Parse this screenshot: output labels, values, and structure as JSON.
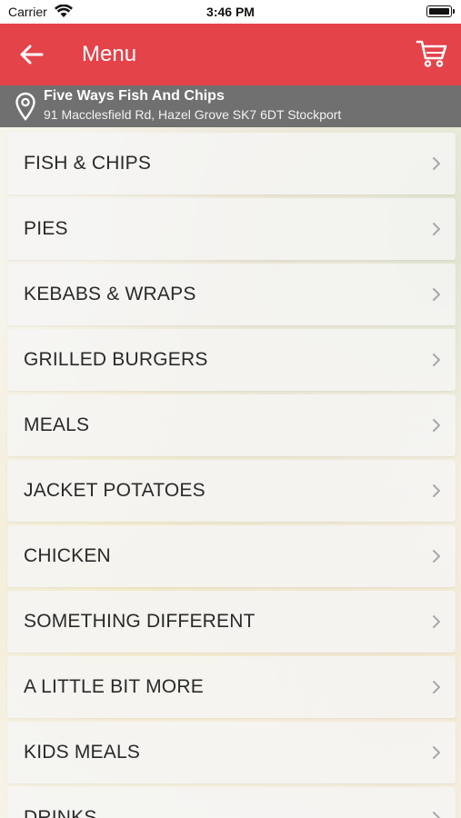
{
  "status_bar": {
    "carrier": "Carrier",
    "time": "3:46 PM"
  },
  "header": {
    "title": "Menu",
    "back_icon": "arrow-left-icon",
    "cart_icon": "cart-icon",
    "color": "#e4434a"
  },
  "location": {
    "name": "Five Ways Fish And Chips",
    "address": "91 Macclesfield Rd, Hazel Grove SK7 6DT Stockport",
    "icon": "map-pin-icon"
  },
  "menu": {
    "items": [
      {
        "label": "FISH & CHIPS"
      },
      {
        "label": "PIES"
      },
      {
        "label": "KEBABS & WRAPS"
      },
      {
        "label": "GRILLED BURGERS"
      },
      {
        "label": "MEALS"
      },
      {
        "label": "JACKET POTATOES"
      },
      {
        "label": "CHICKEN"
      },
      {
        "label": "SOMETHING DIFFERENT"
      },
      {
        "label": "A LITTLE BIT MORE"
      },
      {
        "label": "KIDS MEALS"
      },
      {
        "label": "DRINKS"
      }
    ]
  }
}
